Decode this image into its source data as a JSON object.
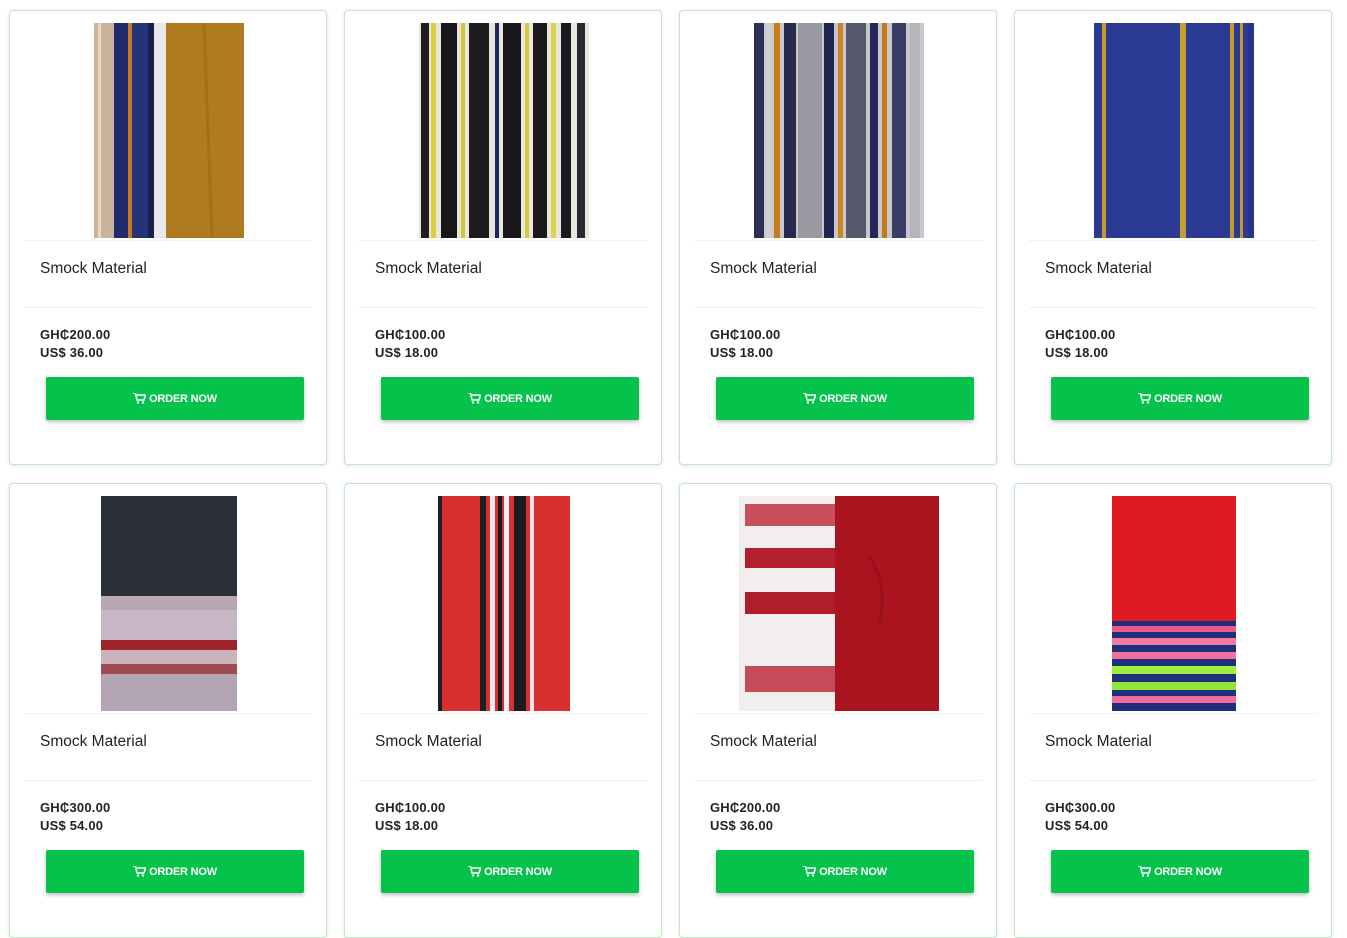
{
  "products": [
    {
      "name": "Smock Material",
      "price_ghs": "GH₵200.00",
      "price_usd": "US$ 36.00",
      "button": "ORDER NOW"
    },
    {
      "name": "Smock Material",
      "price_ghs": "GH₵100.00",
      "price_usd": "US$ 18.00",
      "button": "ORDER NOW"
    },
    {
      "name": "Smock Material",
      "price_ghs": "GH₵100.00",
      "price_usd": "US$ 18.00",
      "button": "ORDER NOW"
    },
    {
      "name": "Smock Material",
      "price_ghs": "GH₵100.00",
      "price_usd": "US$ 18.00",
      "button": "ORDER NOW"
    },
    {
      "name": "Smock Material",
      "price_ghs": "GH₵300.00",
      "price_usd": "US$ 54.00",
      "button": "ORDER NOW"
    },
    {
      "name": "Smock Material",
      "price_ghs": "GH₵100.00",
      "price_usd": "US$ 18.00",
      "button": "ORDER NOW"
    },
    {
      "name": "Smock Material",
      "price_ghs": "GH₵200.00",
      "price_usd": "US$ 36.00",
      "button": "ORDER NOW"
    },
    {
      "name": "Smock Material",
      "price_ghs": "GH₵300.00",
      "price_usd": "US$ 54.00",
      "button": "ORDER NOW"
    }
  ],
  "icons": {
    "button_icon": "cart-icon"
  },
  "colors": {
    "button": "#04c24a",
    "card_border": "#bfe8c4"
  }
}
